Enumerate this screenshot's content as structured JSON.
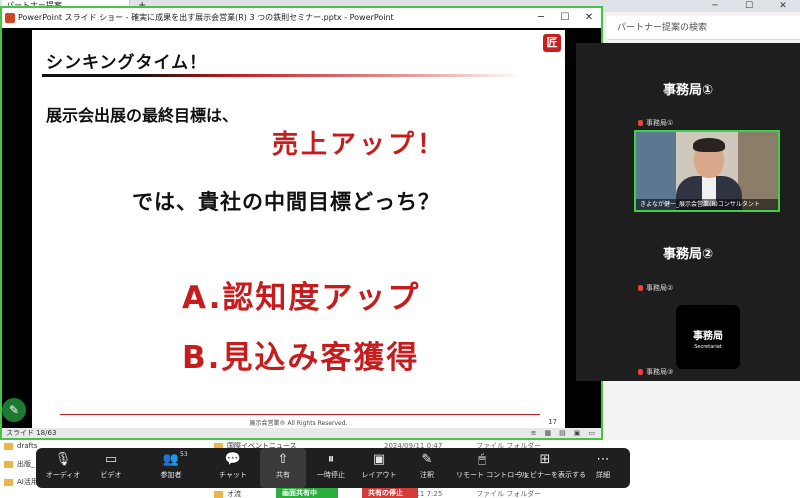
{
  "browser": {
    "tab_label": "パートナー提案",
    "new_tab": "+",
    "min": "─",
    "max": "☐",
    "close": "✕"
  },
  "search": {
    "placeholder": "パートナー提案の検索"
  },
  "powerpoint": {
    "title": "PowerPoint スライド ショー - 確実に成果を出す展示会営業(R) 3 つの鉄則セミナー.pptx - PowerPoint",
    "win_min": "─",
    "win_max": "☐",
    "win_close": "✕",
    "slide": {
      "heading": "シンキングタイム！",
      "line1": "展示会出展の最終目標は、",
      "line2": "売上アップ！",
      "line3": "では、貴社の中間目標どっち？",
      "option_a": "A.認知度アップ",
      "option_b": "B.見込み客獲得",
      "footer": "展示会営業® All Rights Reserved.",
      "page_number": "17",
      "logo_char": "匠"
    },
    "status": {
      "slide_counter": "スライド 18/63"
    }
  },
  "explorer": {
    "items": [
      {
        "name": "drafts"
      },
      {
        "name": "出版_"
      },
      {
        "name": "AI活用"
      },
      {
        "name": "国際イベントニュース",
        "date": "2024/09/11 0:47",
        "type": "ファイル フォルダー"
      },
      {
        "name": "オ流",
        "date": "2024/09/11 7:25",
        "type": "ファイル フォルダー"
      }
    ]
  },
  "meeting": {
    "section1_title": "事務局①",
    "section1_tag": "事務局①",
    "camera_caption": "きよなが健一_展示会営業(R)コンサルタント",
    "section2_title": "事務局②",
    "section2_tag": "事務局②",
    "avatar_label": "事務局",
    "avatar_sub": "Secretariat",
    "section3_tag": "事務局③"
  },
  "toolbar": {
    "audio": "オーディオ",
    "video": "ビデオ",
    "participants": "参加者",
    "participants_count": "53",
    "chat": "チャット",
    "share": "共有",
    "pause": "一時停止",
    "layout": "レイアウト",
    "annotate": "注釈",
    "remote": "リモート コントロール",
    "webinar": "ウェビナーを表示する",
    "more": "詳細",
    "sharing_status": "画面共有中",
    "stop_share": "共有の停止"
  },
  "colors": {
    "accent_red": "#c51d1d",
    "share_green": "#2cae3f",
    "stop_red": "#d33b3b",
    "active_border": "#3bd14a"
  }
}
